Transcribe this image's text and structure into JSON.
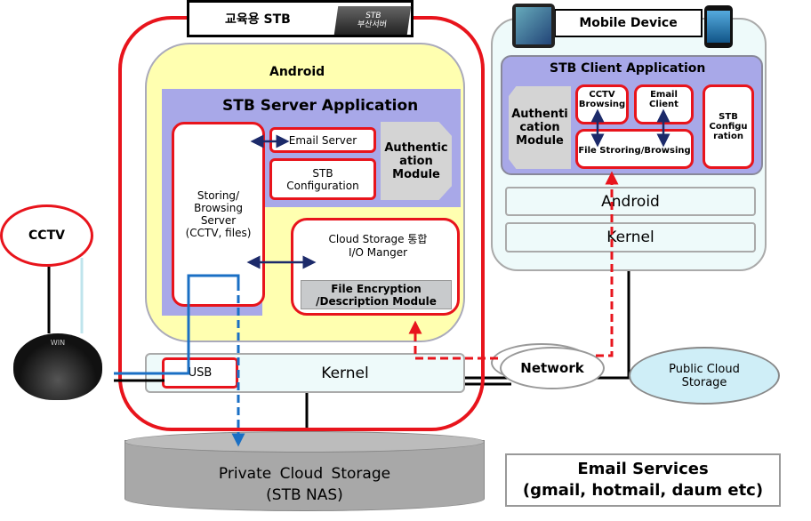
{
  "stb": {
    "title": "교육용 STB",
    "device_label_1": "STB",
    "device_label_2": "부산서버",
    "android": "Android",
    "server_app": "STB Server Application",
    "storing_server": "Storing/ Browsing Server (CCTV, files)",
    "email_server": "Email Server",
    "config": "STB Configuration",
    "auth": "Authentic ation Module",
    "cloud_io": "Cloud Storage 통합 I/O Manger",
    "encryption": "File Encryption /Description Module",
    "kernel": "Kernel",
    "usb": "USB"
  },
  "cctv": {
    "label": "CCTV",
    "camera_brand": "WIN"
  },
  "private_storage": {
    "line1": "Private Cloud Storage",
    "line2": "(STB NAS)"
  },
  "mobile": {
    "title": "Mobile Device",
    "client_app": "STB Client Application",
    "auth": "Authenti cation Module",
    "cctv_browsing": "CCTV Browsing",
    "email_client": "Email Client",
    "file_storing": "File Stroring/Browsing",
    "config": "STB Configu ration",
    "android": "Android",
    "kernel": "Kernel"
  },
  "network": "Network",
  "public_cloud": "Public Cloud Storage",
  "email_services": {
    "line1": "Email Services",
    "line2": "(gmail, hotmail, daum etc)"
  },
  "colors": {
    "red": "#e8141c",
    "purple": "#a8a8e8",
    "yellow": "#ffffb0",
    "blue": "#1a6fc4"
  }
}
